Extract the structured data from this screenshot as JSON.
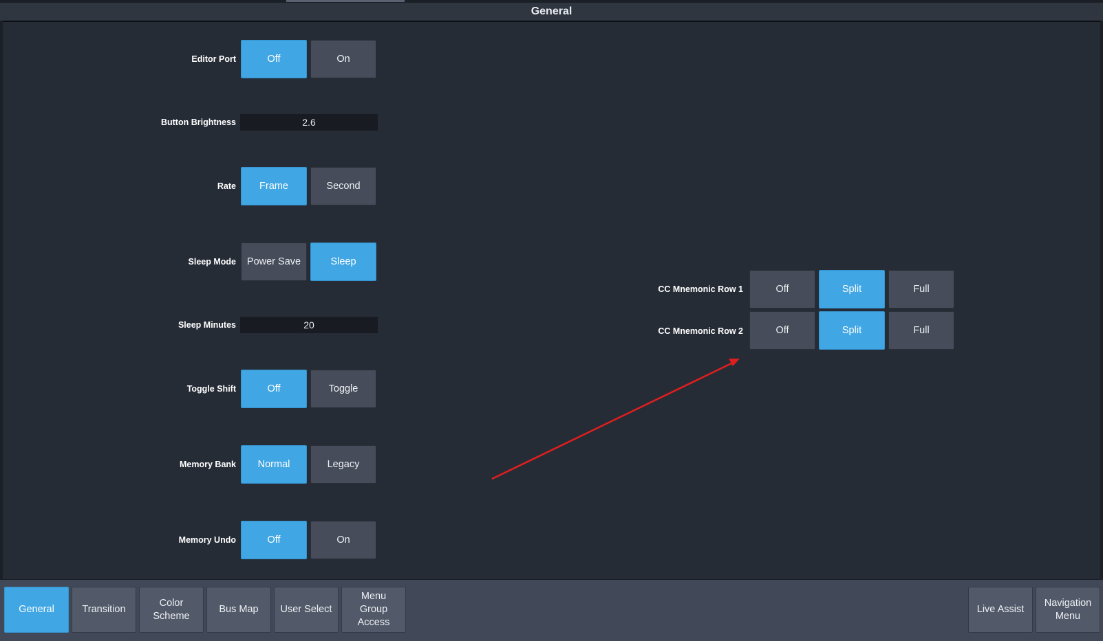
{
  "header": {
    "title": "General"
  },
  "settings": {
    "editor_port": {
      "label": "Editor Port",
      "options": [
        "Off",
        "On"
      ],
      "selected": "Off"
    },
    "button_brightness": {
      "label": "Button Brightness",
      "value": "2.6"
    },
    "rate": {
      "label": "Rate",
      "options": [
        "Frame",
        "Second"
      ],
      "selected": "Frame"
    },
    "sleep_mode": {
      "label": "Sleep Mode",
      "options": [
        "Power Save",
        "Sleep"
      ],
      "selected": "Sleep"
    },
    "sleep_minutes": {
      "label": "Sleep Minutes",
      "value": "20"
    },
    "toggle_shift": {
      "label": "Toggle Shift",
      "options": [
        "Off",
        "Toggle"
      ],
      "selected": "Off"
    },
    "memory_bank": {
      "label": "Memory Bank",
      "options": [
        "Normal",
        "Legacy"
      ],
      "selected": "Normal"
    },
    "memory_undo": {
      "label": "Memory Undo",
      "options": [
        "Off",
        "On"
      ],
      "selected": "Off"
    },
    "cc_mnemonic_row_1": {
      "label": "CC Mnemonic Row 1",
      "options": [
        "Off",
        "Split",
        "Full"
      ],
      "selected": "Split"
    },
    "cc_mnemonic_row_2": {
      "label": "CC Mnemonic Row 2",
      "options": [
        "Off",
        "Split",
        "Full"
      ],
      "selected": "Split"
    }
  },
  "annotation": {
    "arrow_color": "#e01e1e"
  },
  "bottom_nav": {
    "tabs": [
      "General",
      "Transition",
      "Color\nScheme",
      "Bus Map",
      "User Select",
      "Menu\nGroup\nAccess"
    ],
    "active": "General",
    "right": [
      "Live Assist",
      "Navigation\nMenu"
    ]
  },
  "colors": {
    "accent": "#40a6e4",
    "button": "#464c59",
    "background": "#262c36"
  }
}
